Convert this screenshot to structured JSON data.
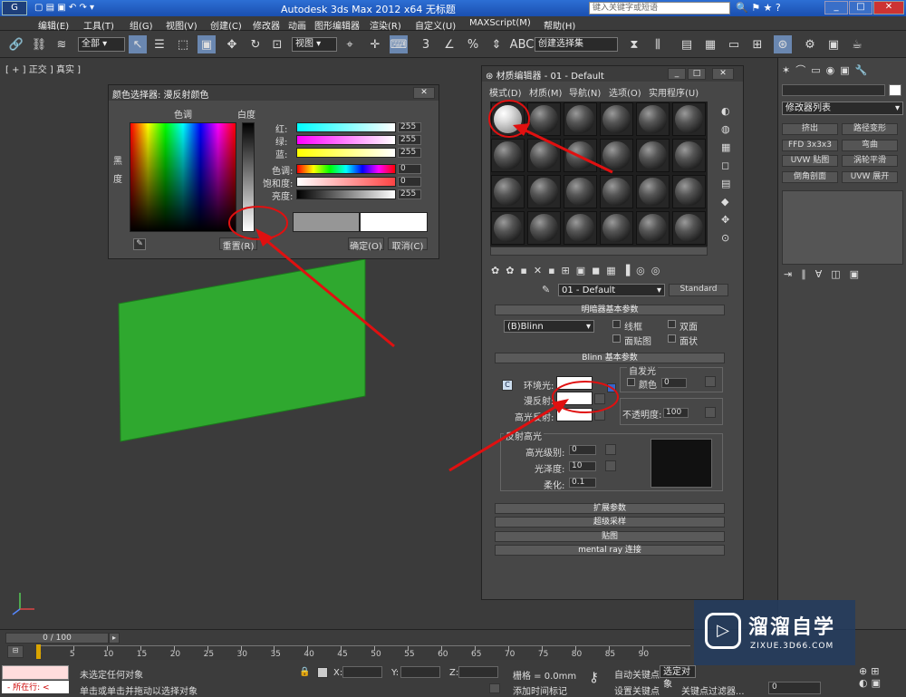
{
  "window": {
    "title": "Autodesk 3ds Max  2012 x64      无标题",
    "search_placeholder": "键入关键字或短语"
  },
  "menu": [
    "编辑(E)",
    "工具(T)",
    "组(G)",
    "视图(V)",
    "创建(C)",
    "修改器",
    "动画",
    "图形编辑器",
    "渲染(R)",
    "自定义(U)",
    "MAXScript(M)",
    "帮助(H)"
  ],
  "toolbar": {
    "selection_filter": "全部",
    "ref_coord": "视图",
    "named_sel": "创建选择集"
  },
  "viewport": {
    "label": "[ + ] 正交 ] 真实 ]"
  },
  "color_picker": {
    "title": "颜色选择器: 漫反射颜色",
    "hue_label": "色调",
    "whiteness_label": "白度",
    "black_label": "黑",
    "degree_label": "度",
    "channels": [
      {
        "label": "红:",
        "value": "255"
      },
      {
        "label": "绿:",
        "value": "255"
      },
      {
        "label": "蓝:",
        "value": "255"
      },
      {
        "label": "色调:",
        "value": "0"
      },
      {
        "label": "饱和度:",
        "value": "0"
      },
      {
        "label": "亮度:",
        "value": "255"
      }
    ],
    "reset": "重置(R)",
    "ok": "确定(O)",
    "cancel": "取消(C)"
  },
  "material_editor": {
    "title": "材质编辑器 - 01 - Default",
    "menus": [
      "模式(D)",
      "材质(M)",
      "导航(N)",
      "选项(O)",
      "实用程序(U)"
    ],
    "material_name": "01 - Default",
    "material_type": "Standard",
    "shader_rollout": "明暗器基本参数",
    "shader": "(B)Blinn",
    "shader_opts": [
      "线框",
      "双面",
      "面贴图",
      "面状"
    ],
    "blinn_rollout": "Blinn 基本参数",
    "self_illum": "自发光",
    "color_label": "颜色",
    "self_illum_value": "0",
    "ambient": "环境光:",
    "diffuse": "漫反射:",
    "specular": "高光反射:",
    "opacity_label": "不透明度:",
    "opacity": "100",
    "spec_highlights": "反射高光",
    "spec_level_label": "高光级别:",
    "spec_level": "0",
    "glossiness_label": "光泽度:",
    "glossiness": "10",
    "soften_label": "柔化:",
    "soften": "0.1",
    "rollouts": [
      "扩展参数",
      "超级采样",
      "贴图",
      "mental ray 连接"
    ]
  },
  "command_panel": {
    "modifier_list": "修改器列表",
    "buttons": [
      "挤出",
      "路径变形",
      "FFD 3x3x3",
      "弯曲",
      "UVW 贴图",
      "涡轮平滑",
      "倒角剖面",
      "UVW 展开"
    ]
  },
  "timeline": {
    "frame": "0 / 100",
    "ticks": [
      "0",
      "5",
      "10",
      "15",
      "20",
      "25",
      "30",
      "35",
      "40",
      "45",
      "50",
      "55",
      "60",
      "65",
      "70",
      "75",
      "80",
      "85",
      "90"
    ]
  },
  "status": {
    "running": "所在行:",
    "msg1": "未选定任何对象",
    "msg2": "单击或单击并拖动以选择对象",
    "x": "X:",
    "y": "Y:",
    "z": "Z:",
    "grid": "栅格 = 0.0mm",
    "add_tag": "添加时间标记",
    "auto_key": "自动关键点",
    "set_key": "设置关键点",
    "selected": "选定对象",
    "key_filters": "关键点过滤器...",
    "frame_value": "0"
  },
  "watermark": {
    "brand": "溜溜自学",
    "url": "ZIXUE.3D66.COM"
  },
  "colors": {
    "green_plane": "#2fa82f",
    "annotation": "#e01010"
  }
}
